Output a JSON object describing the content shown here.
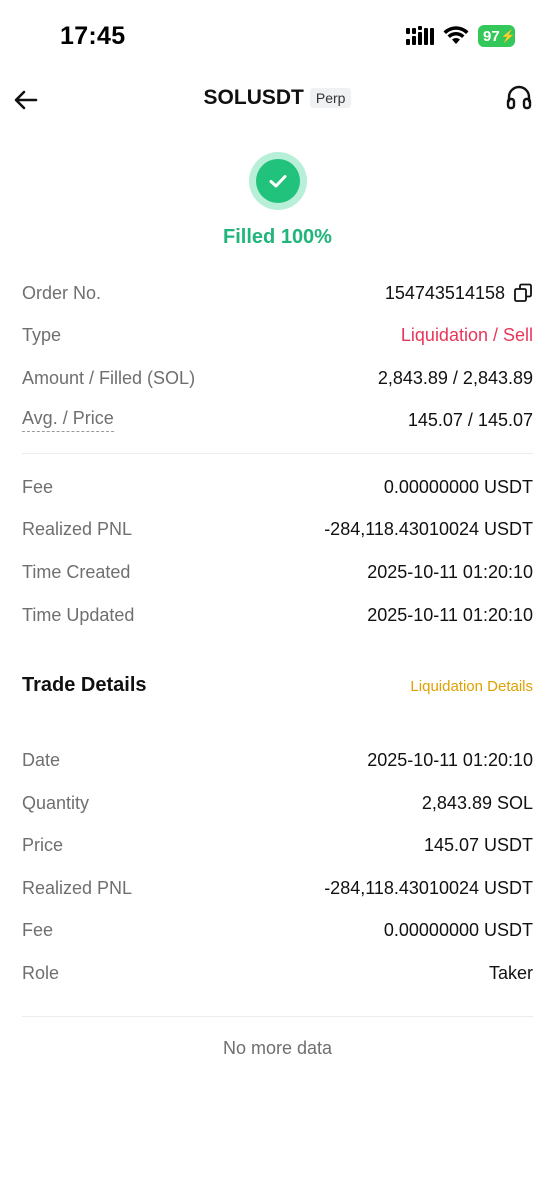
{
  "status_bar": {
    "time": "17:45",
    "battery": "97"
  },
  "nav": {
    "title": "SOLUSDT",
    "badge": "Perp"
  },
  "order_status": "Filled 100%",
  "order_info": [
    {
      "label": "Order No.",
      "value": "154743514158"
    },
    {
      "label": "Type",
      "value": "Liquidation / Sell"
    },
    {
      "label": "Amount / Filled (SOL)",
      "value": "2,843.89 / 2,843.89"
    },
    {
      "label": "Avg. / Price",
      "value": "145.07 / 145.07"
    }
  ],
  "fee_info": [
    {
      "label": "Fee",
      "value": "0.00000000 USDT"
    },
    {
      "label": "Realized PNL",
      "value": "-284,118.43010024 USDT"
    },
    {
      "label": "Time Created",
      "value": "2025-10-11 01:20:10"
    },
    {
      "label": "Time Updated",
      "value": "2025-10-11 01:20:10"
    }
  ],
  "trade_details": {
    "title": "Trade Details",
    "link": "Liquidation Details",
    "rows": [
      {
        "label": "Date",
        "value": "2025-10-11 01:20:10"
      },
      {
        "label": "Quantity",
        "value": "2,843.89 SOL"
      },
      {
        "label": "Price",
        "value": "145.07 USDT"
      },
      {
        "label": "Realized PNL",
        "value": "-284,118.43010024 USDT"
      },
      {
        "label": "Fee",
        "value": "0.00000000 USDT"
      },
      {
        "label": "Role",
        "value": "Taker"
      }
    ]
  },
  "footer": "No more data",
  "colors": {
    "success": "#20b57a",
    "sell": "#e8365a",
    "link": "#e0a100"
  }
}
